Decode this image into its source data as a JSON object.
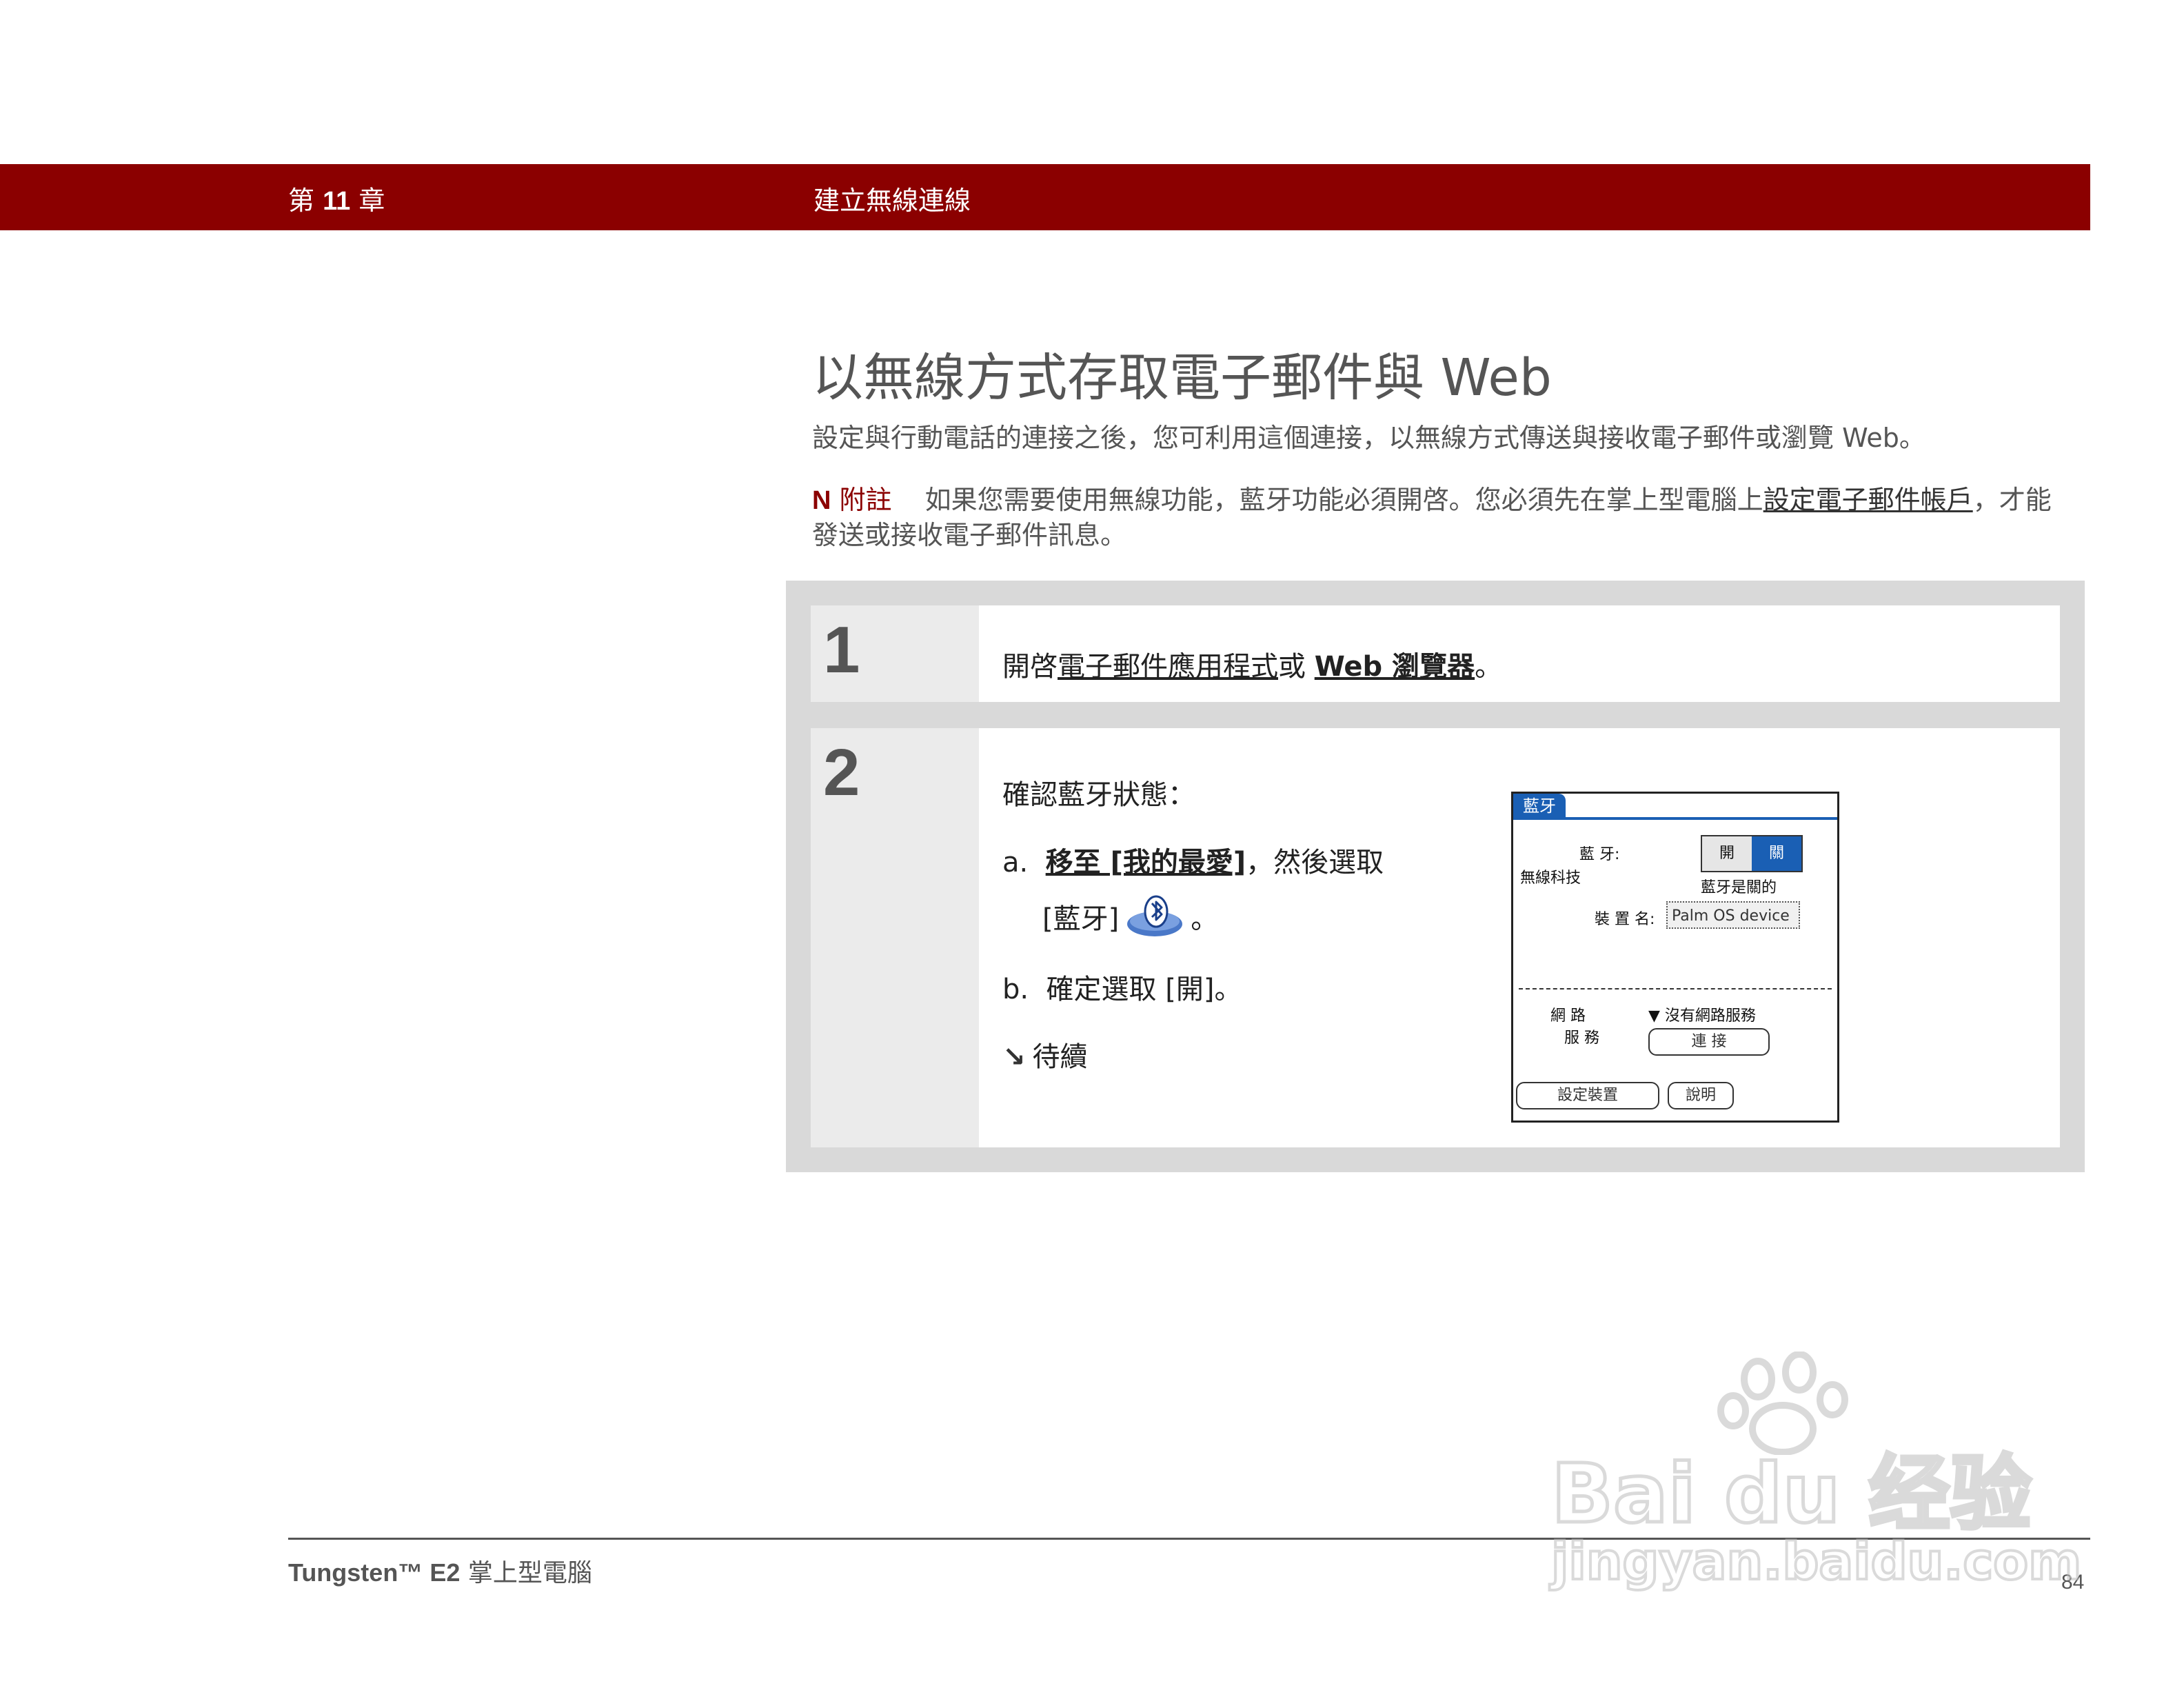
{
  "chapter": {
    "prefix": "第",
    "number": "11",
    "suffix": "章",
    "title": "建立無線連線"
  },
  "page": {
    "title": "以無線方式存取電子郵件與 Web",
    "intro": "設定與行動電話的連接之後，您可利用這個連接，以無線方式傳送與接收電子郵件或瀏覽 Web。"
  },
  "note": {
    "label": "附註",
    "text_before": "如果您需要使用無線功能，藍牙功能必須開啓。您必須先在掌上型電腦上",
    "link": "設定電子郵件帳戶",
    "text_after": "，才能發送或接收電子郵件訊息。"
  },
  "steps": {
    "one": {
      "number": "1",
      "prefix": "開啓",
      "link1": "電子郵件應用程式",
      "mid": "或 ",
      "link2": "Web 瀏覽器",
      "suffix": "。"
    },
    "two": {
      "number": "2",
      "lead": "確認藍牙狀態：",
      "a_marker": "a.",
      "a_link": "移至 [我的最愛]",
      "a_text": "，然後選取",
      "a_line2_before": "[藍牙]",
      "a_line2_after": "。",
      "b_marker": "b.",
      "b_text": "確定選取 [開]。",
      "continued": "待續"
    }
  },
  "device": {
    "tab": "藍牙",
    "bt_label": "藍 牙:",
    "wireless_label": "無線科技",
    "on": "開",
    "off": "關",
    "status": "藍牙是關的",
    "name_label": "裝 置 名:",
    "name_value": "Palm OS device",
    "network_label_1": "網 路",
    "network_label_2": "服 務",
    "network_value": "沒有網路服務",
    "connect": "連 接",
    "setup": "設定裝置",
    "help": "說明"
  },
  "footer": {
    "product": "Tungsten™ E2",
    "product_suffix": "掌上型電腦",
    "page_number": "84"
  },
  "watermark": {
    "brand": "Bai du 经验",
    "url": "jingyan.baidu.com"
  }
}
